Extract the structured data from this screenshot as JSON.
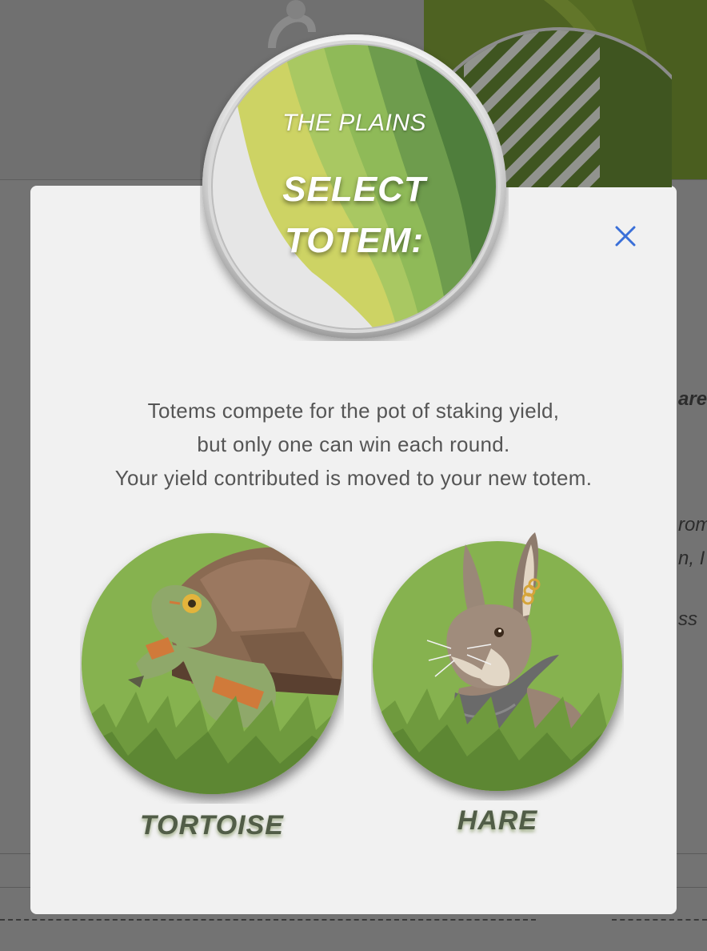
{
  "modal": {
    "subtitle": "THE PLAINS",
    "title_line1": "SELECT",
    "title_line2": "TOTEM:",
    "description": [
      "Totems compete for the pot of staking yield,",
      "but only one can win each round.",
      "Your yield contributed is moved to your new totem."
    ],
    "close_icon": "close-icon",
    "accent_color": "#3a6fd8"
  },
  "totems": [
    {
      "label": "TORTOISE",
      "icon": "tortoise-icon"
    },
    {
      "label": "HARE",
      "icon": "hare-icon"
    }
  ],
  "background": {
    "text_fragments": [
      "are",
      "rom",
      "n, I",
      "ss"
    ]
  }
}
